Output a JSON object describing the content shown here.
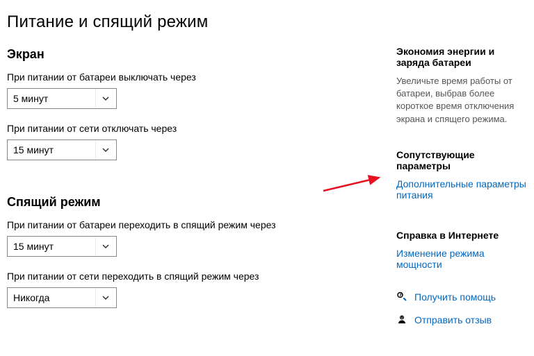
{
  "page": {
    "title": "Питание и спящий режим"
  },
  "sections": {
    "screen": {
      "heading": "Экран",
      "on_battery_off": {
        "label": "При питании от батареи выключать через",
        "value": "5 минут"
      },
      "on_ac_off": {
        "label": "При питании от сети отключать через",
        "value": "15 минут"
      }
    },
    "sleep": {
      "heading": "Спящий режим",
      "on_battery_sleep": {
        "label": "При питании от батареи переходить в спящий режим через",
        "value": "15 минут"
      },
      "on_ac_sleep": {
        "label": "При питании от сети переходить в спящий режим через",
        "value": "Никогда"
      }
    }
  },
  "sidebar": {
    "battery_saver": {
      "heading": "Экономия энергии и заряда батареи",
      "desc": "Увеличьте время работы от батареи, выбрав более короткое время отключения экрана и спящего режима."
    },
    "related": {
      "heading": "Сопутствующие параметры",
      "additional_power_link": "Дополнительные параметры питания"
    },
    "help_web": {
      "heading": "Справка в Интернете",
      "change_power_mode_link": "Изменение режима мощности"
    },
    "footer": {
      "get_help": "Получить помощь",
      "feedback": "Отправить отзыв"
    }
  }
}
